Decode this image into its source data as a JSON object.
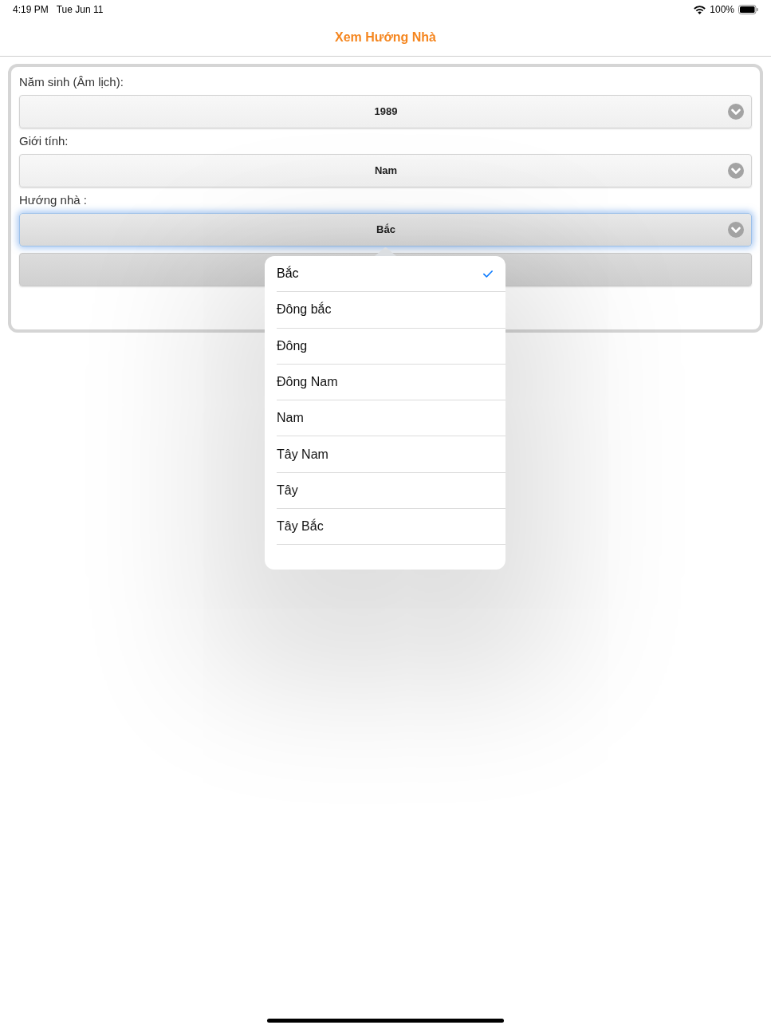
{
  "status_bar": {
    "time": "4:19 PM",
    "date": "Tue Jun 11",
    "battery": "100%"
  },
  "nav": {
    "title": "Xem Hướng Nhà"
  },
  "form": {
    "fields": [
      {
        "label": "Năm sinh (Âm lịch):",
        "value": "1989",
        "focused": false
      },
      {
        "label": "Giới tính:",
        "value": "Nam",
        "focused": false
      },
      {
        "label": "Hướng nhà :",
        "value": "Bắc",
        "focused": true
      }
    ]
  },
  "popover": {
    "options": [
      {
        "label": "Bắc",
        "selected": true
      },
      {
        "label": "Đông bắc",
        "selected": false
      },
      {
        "label": "Đông",
        "selected": false
      },
      {
        "label": "Đông Nam",
        "selected": false
      },
      {
        "label": "Nam",
        "selected": false
      },
      {
        "label": "Tây Nam",
        "selected": false
      },
      {
        "label": "Tây",
        "selected": false
      },
      {
        "label": "Tây Bắc",
        "selected": false
      }
    ]
  }
}
